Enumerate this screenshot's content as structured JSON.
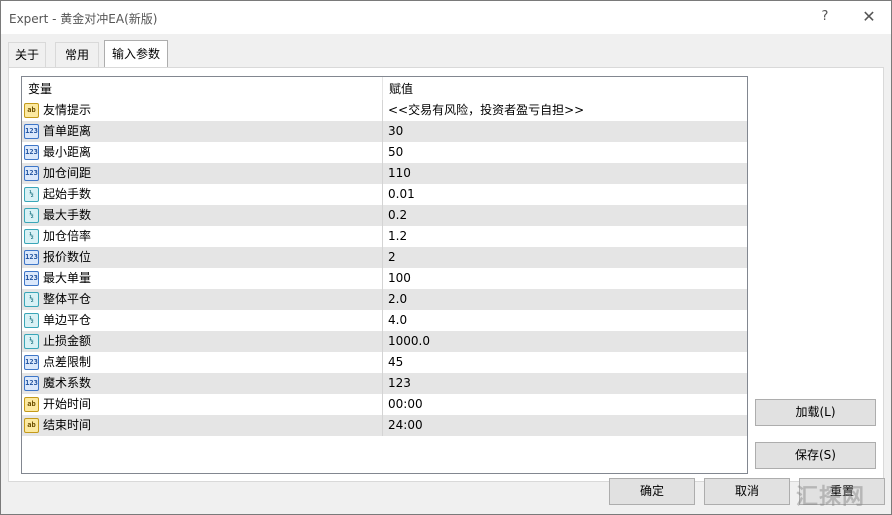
{
  "window": {
    "title": "Expert - 黄金对冲EA(新版)",
    "help_label": "?",
    "close_label": "✕"
  },
  "tabs": [
    {
      "label": "关于"
    },
    {
      "label": "常用"
    },
    {
      "label": "输入参数",
      "active": true
    }
  ],
  "grid": {
    "columns": [
      "变量",
      "赋值"
    ],
    "rows": [
      {
        "type": "string",
        "icon": "ab",
        "name": "友情提示",
        "value": "<<交易有风险，投资者盈亏自担>>"
      },
      {
        "type": "int",
        "icon": "123",
        "name": "首单距离",
        "value": "30"
      },
      {
        "type": "int",
        "icon": "123",
        "name": "最小距离",
        "value": "50"
      },
      {
        "type": "int",
        "icon": "123",
        "name": "加仓间距",
        "value": "110"
      },
      {
        "type": "double",
        "icon": "½",
        "name": "起始手数",
        "value": "0.01"
      },
      {
        "type": "double",
        "icon": "½",
        "name": "最大手数",
        "value": "0.2"
      },
      {
        "type": "double",
        "icon": "½",
        "name": "加仓倍率",
        "value": "1.2"
      },
      {
        "type": "int",
        "icon": "123",
        "name": "报价数位",
        "value": "2"
      },
      {
        "type": "int",
        "icon": "123",
        "name": "最大单量",
        "value": "100"
      },
      {
        "type": "double",
        "icon": "½",
        "name": "整体平仓",
        "value": "2.0"
      },
      {
        "type": "double",
        "icon": "½",
        "name": "单边平仓",
        "value": "4.0"
      },
      {
        "type": "double",
        "icon": "½",
        "name": "止损金额",
        "value": "1000.0"
      },
      {
        "type": "int",
        "icon": "123",
        "name": "点差限制",
        "value": "45"
      },
      {
        "type": "int",
        "icon": "123",
        "name": "魔术系数",
        "value": "123"
      },
      {
        "type": "string",
        "icon": "ab",
        "name": "开始时间",
        "value": "00:00"
      },
      {
        "type": "string",
        "icon": "ab",
        "name": "结束时间",
        "value": "24:00"
      }
    ]
  },
  "buttons": {
    "load": "加载(L)",
    "save": "保存(S)",
    "ok": "确定",
    "cancel": "取消",
    "reset": "重置"
  },
  "watermark": "汇探网"
}
